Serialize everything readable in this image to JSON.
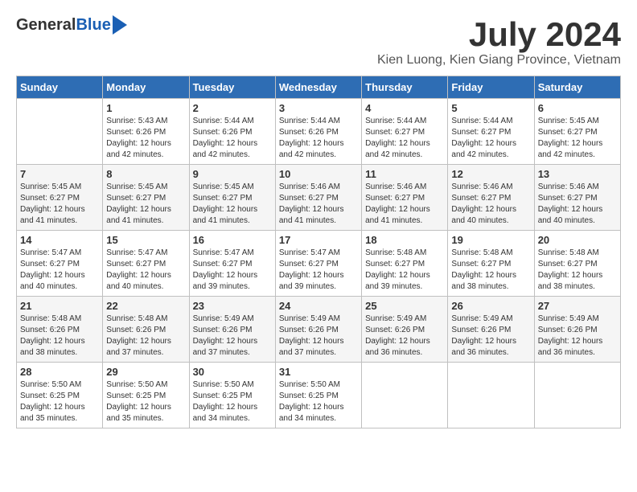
{
  "logo": {
    "general": "General",
    "blue": "Blue"
  },
  "title": {
    "month": "July 2024",
    "location": "Kien Luong, Kien Giang Province, Vietnam"
  },
  "weekdays": [
    "Sunday",
    "Monday",
    "Tuesday",
    "Wednesday",
    "Thursday",
    "Friday",
    "Saturday"
  ],
  "weeks": [
    [
      {
        "day": "",
        "sunrise": "",
        "sunset": "",
        "daylight": ""
      },
      {
        "day": "1",
        "sunrise": "Sunrise: 5:43 AM",
        "sunset": "Sunset: 6:26 PM",
        "daylight": "Daylight: 12 hours and 42 minutes."
      },
      {
        "day": "2",
        "sunrise": "Sunrise: 5:44 AM",
        "sunset": "Sunset: 6:26 PM",
        "daylight": "Daylight: 12 hours and 42 minutes."
      },
      {
        "day": "3",
        "sunrise": "Sunrise: 5:44 AM",
        "sunset": "Sunset: 6:26 PM",
        "daylight": "Daylight: 12 hours and 42 minutes."
      },
      {
        "day": "4",
        "sunrise": "Sunrise: 5:44 AM",
        "sunset": "Sunset: 6:27 PM",
        "daylight": "Daylight: 12 hours and 42 minutes."
      },
      {
        "day": "5",
        "sunrise": "Sunrise: 5:44 AM",
        "sunset": "Sunset: 6:27 PM",
        "daylight": "Daylight: 12 hours and 42 minutes."
      },
      {
        "day": "6",
        "sunrise": "Sunrise: 5:45 AM",
        "sunset": "Sunset: 6:27 PM",
        "daylight": "Daylight: 12 hours and 42 minutes."
      }
    ],
    [
      {
        "day": "7",
        "sunrise": "Sunrise: 5:45 AM",
        "sunset": "Sunset: 6:27 PM",
        "daylight": "Daylight: 12 hours and 41 minutes."
      },
      {
        "day": "8",
        "sunrise": "Sunrise: 5:45 AM",
        "sunset": "Sunset: 6:27 PM",
        "daylight": "Daylight: 12 hours and 41 minutes."
      },
      {
        "day": "9",
        "sunrise": "Sunrise: 5:45 AM",
        "sunset": "Sunset: 6:27 PM",
        "daylight": "Daylight: 12 hours and 41 minutes."
      },
      {
        "day": "10",
        "sunrise": "Sunrise: 5:46 AM",
        "sunset": "Sunset: 6:27 PM",
        "daylight": "Daylight: 12 hours and 41 minutes."
      },
      {
        "day": "11",
        "sunrise": "Sunrise: 5:46 AM",
        "sunset": "Sunset: 6:27 PM",
        "daylight": "Daylight: 12 hours and 41 minutes."
      },
      {
        "day": "12",
        "sunrise": "Sunrise: 5:46 AM",
        "sunset": "Sunset: 6:27 PM",
        "daylight": "Daylight: 12 hours and 40 minutes."
      },
      {
        "day": "13",
        "sunrise": "Sunrise: 5:46 AM",
        "sunset": "Sunset: 6:27 PM",
        "daylight": "Daylight: 12 hours and 40 minutes."
      }
    ],
    [
      {
        "day": "14",
        "sunrise": "Sunrise: 5:47 AM",
        "sunset": "Sunset: 6:27 PM",
        "daylight": "Daylight: 12 hours and 40 minutes."
      },
      {
        "day": "15",
        "sunrise": "Sunrise: 5:47 AM",
        "sunset": "Sunset: 6:27 PM",
        "daylight": "Daylight: 12 hours and 40 minutes."
      },
      {
        "day": "16",
        "sunrise": "Sunrise: 5:47 AM",
        "sunset": "Sunset: 6:27 PM",
        "daylight": "Daylight: 12 hours and 39 minutes."
      },
      {
        "day": "17",
        "sunrise": "Sunrise: 5:47 AM",
        "sunset": "Sunset: 6:27 PM",
        "daylight": "Daylight: 12 hours and 39 minutes."
      },
      {
        "day": "18",
        "sunrise": "Sunrise: 5:48 AM",
        "sunset": "Sunset: 6:27 PM",
        "daylight": "Daylight: 12 hours and 39 minutes."
      },
      {
        "day": "19",
        "sunrise": "Sunrise: 5:48 AM",
        "sunset": "Sunset: 6:27 PM",
        "daylight": "Daylight: 12 hours and 38 minutes."
      },
      {
        "day": "20",
        "sunrise": "Sunrise: 5:48 AM",
        "sunset": "Sunset: 6:27 PM",
        "daylight": "Daylight: 12 hours and 38 minutes."
      }
    ],
    [
      {
        "day": "21",
        "sunrise": "Sunrise: 5:48 AM",
        "sunset": "Sunset: 6:26 PM",
        "daylight": "Daylight: 12 hours and 38 minutes."
      },
      {
        "day": "22",
        "sunrise": "Sunrise: 5:48 AM",
        "sunset": "Sunset: 6:26 PM",
        "daylight": "Daylight: 12 hours and 37 minutes."
      },
      {
        "day": "23",
        "sunrise": "Sunrise: 5:49 AM",
        "sunset": "Sunset: 6:26 PM",
        "daylight": "Daylight: 12 hours and 37 minutes."
      },
      {
        "day": "24",
        "sunrise": "Sunrise: 5:49 AM",
        "sunset": "Sunset: 6:26 PM",
        "daylight": "Daylight: 12 hours and 37 minutes."
      },
      {
        "day": "25",
        "sunrise": "Sunrise: 5:49 AM",
        "sunset": "Sunset: 6:26 PM",
        "daylight": "Daylight: 12 hours and 36 minutes."
      },
      {
        "day": "26",
        "sunrise": "Sunrise: 5:49 AM",
        "sunset": "Sunset: 6:26 PM",
        "daylight": "Daylight: 12 hours and 36 minutes."
      },
      {
        "day": "27",
        "sunrise": "Sunrise: 5:49 AM",
        "sunset": "Sunset: 6:26 PM",
        "daylight": "Daylight: 12 hours and 36 minutes."
      }
    ],
    [
      {
        "day": "28",
        "sunrise": "Sunrise: 5:50 AM",
        "sunset": "Sunset: 6:25 PM",
        "daylight": "Daylight: 12 hours and 35 minutes."
      },
      {
        "day": "29",
        "sunrise": "Sunrise: 5:50 AM",
        "sunset": "Sunset: 6:25 PM",
        "daylight": "Daylight: 12 hours and 35 minutes."
      },
      {
        "day": "30",
        "sunrise": "Sunrise: 5:50 AM",
        "sunset": "Sunset: 6:25 PM",
        "daylight": "Daylight: 12 hours and 34 minutes."
      },
      {
        "day": "31",
        "sunrise": "Sunrise: 5:50 AM",
        "sunset": "Sunset: 6:25 PM",
        "daylight": "Daylight: 12 hours and 34 minutes."
      },
      {
        "day": "",
        "sunrise": "",
        "sunset": "",
        "daylight": ""
      },
      {
        "day": "",
        "sunrise": "",
        "sunset": "",
        "daylight": ""
      },
      {
        "day": "",
        "sunrise": "",
        "sunset": "",
        "daylight": ""
      }
    ]
  ]
}
